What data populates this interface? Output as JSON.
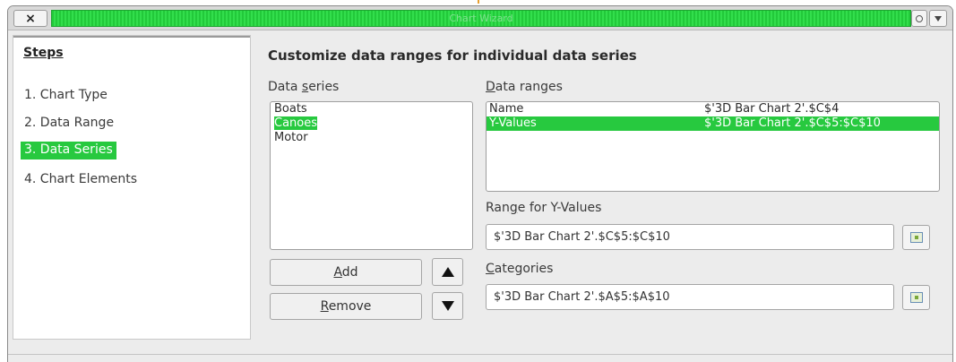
{
  "window": {
    "title": "Chart Wizard",
    "close_label": "×",
    "accent_color": "#27c93f"
  },
  "steps": {
    "heading": "Steps",
    "items": [
      {
        "label": "1. Chart Type",
        "active": false
      },
      {
        "label": "2. Data Range",
        "active": false
      },
      {
        "label": "3. Data Series",
        "active": true
      },
      {
        "label": "4. Chart Elements",
        "active": false
      }
    ]
  },
  "main": {
    "heading": "Customize data ranges for individual data series",
    "data_series_label_pre": "Data ",
    "data_series_label_u": "s",
    "data_series_label_post": "eries",
    "series": [
      {
        "name": "Boats",
        "selected": false
      },
      {
        "name": "Canoes",
        "selected": true
      },
      {
        "name": "Motor",
        "selected": false
      }
    ],
    "data_ranges_label_u": "D",
    "data_ranges_label_post": "ata ranges",
    "ranges": [
      {
        "role": "Name",
        "range": "$'3D Bar Chart 2'.$C$4",
        "selected": false
      },
      {
        "role": "Y-Values",
        "range": "$'3D Bar Chart 2'.$C$5:$C$10",
        "selected": true
      }
    ],
    "range_for_label_pre": "Ran",
    "range_for_label_u": "g",
    "range_for_label_post": "e for Y-Values",
    "range_for_value": "$'3D Bar Chart 2'.$C$5:$C$10",
    "categories_label_u": "C",
    "categories_label_post": "ategories",
    "categories_value": "$'3D Bar Chart 2'.$A$5:$A$10",
    "add_button_u": "A",
    "add_button_post": "dd",
    "remove_button_u": "R",
    "remove_button_post": "emove",
    "move_up_icon": "triangle-up-icon",
    "move_down_icon": "triangle-down-icon",
    "select_range_icon": "select-range-icon"
  }
}
